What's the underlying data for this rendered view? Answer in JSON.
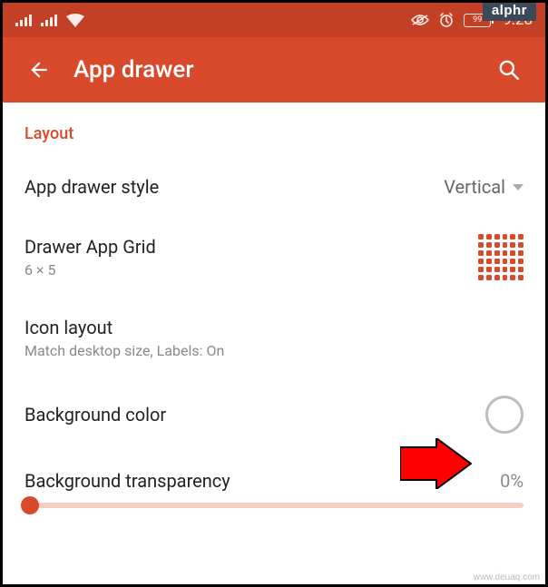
{
  "badge": "alphr",
  "statusbar": {
    "battery": "99",
    "time": "9:28"
  },
  "appbar": {
    "title": "App drawer"
  },
  "section": "Layout",
  "rows": {
    "style": {
      "title": "App drawer style",
      "value": "Vertical"
    },
    "grid": {
      "title": "Drawer App Grid",
      "sub": "6 × 5"
    },
    "icon": {
      "title": "Icon layout",
      "sub": "Match desktop size, Labels: On"
    },
    "bgcolor": {
      "title": "Background color"
    },
    "bgtrans": {
      "title": "Background transparency",
      "value": "0%"
    }
  },
  "watermark": "www.deuaq.com"
}
